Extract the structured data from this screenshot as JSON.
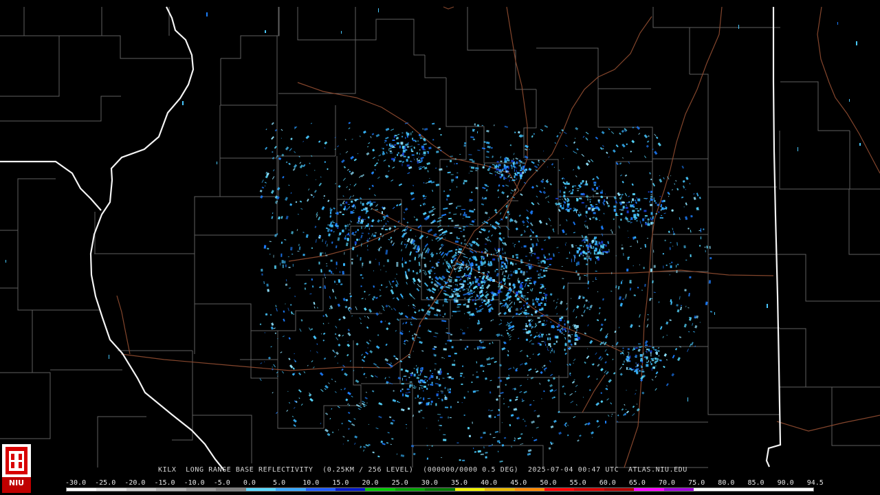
{
  "caption": {
    "station": "KILX",
    "product": "LONG RANGE BASE REFLECTIVITY",
    "resolution": "(0.25KM / 256 LEVEL)",
    "volume": "(000000/0000 0.5 DEG)",
    "timestamp": "2025-07-04 00:47 UTC",
    "site": "ATLAS.NIU.EDU"
  },
  "legend": {
    "labels": [
      "-30.0",
      "-25.0",
      "-20.0",
      "-15.0",
      "-10.0",
      "-5.0",
      "0.0",
      "5.0",
      "10.0",
      "15.0",
      "20.0",
      "25.0",
      "30.0",
      "35.0",
      "40.0",
      "45.0",
      "50.0",
      "55.0",
      "60.0",
      "65.0",
      "70.0",
      "75.0",
      "80.0",
      "85.0",
      "90.0",
      "94.5"
    ],
    "colors": [
      "#ffffff",
      "#e6e6e6",
      "#cccccc",
      "#b3b3b3",
      "#999999",
      "#808080",
      "#5ad8ff",
      "#39a8ff",
      "#1f5cff",
      "#0018c8",
      "#00c800",
      "#00a000",
      "#007800",
      "#f0f000",
      "#e8b800",
      "#ff8a00",
      "#ff0000",
      "#d40000",
      "#b00000",
      "#ff00ff",
      "#a000d8",
      "#ffffff",
      "#ffffff",
      "#ffffff",
      "#ffffff"
    ]
  },
  "logo": {
    "text": "NIU"
  },
  "colors": {
    "background": "#000000",
    "county_lines": "#6a6a6a",
    "state_lines": "#ffffff",
    "highways": "#8a3f2a",
    "echo_light": "#47c7ff",
    "echo_mid": "#1c7dff",
    "echo_dark": "#173fd6"
  },
  "map": {
    "radar_site": "KILX",
    "echo_coverage": "scattered clear-air returns centered near radar site"
  }
}
